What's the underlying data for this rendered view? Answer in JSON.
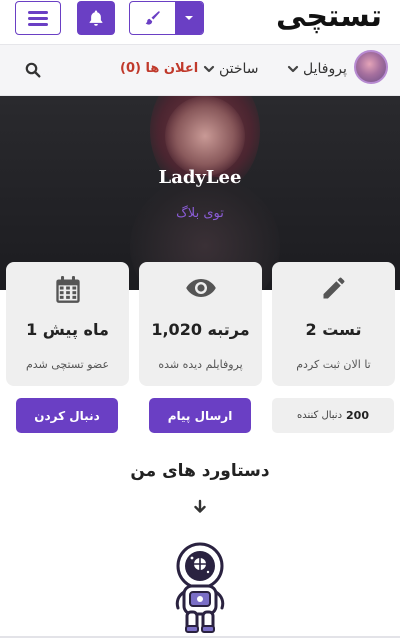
{
  "header": {
    "logo_text": "تستچی",
    "menu_icon": "hamburger-icon",
    "bell_icon": "bell-icon",
    "theme_icon": "brush-icon",
    "accent_color": "#6a3fc4"
  },
  "nav": {
    "profile_label": "پروفایل",
    "build_label": "ساختن",
    "ads_label": "اعلان ها (0)",
    "search_icon": "search-icon"
  },
  "hero": {
    "username": "LadyLee",
    "subtitle": "توی بلاگ"
  },
  "stats": [
    {
      "icon": "pencil-icon",
      "value": "2 تست",
      "label": "تا الان ثبت کردم"
    },
    {
      "icon": "eye-icon",
      "value": "1,020 مرتبه",
      "label": "پروفایلم دیده شده"
    },
    {
      "icon": "calendar-icon",
      "value": "1 ماه پیش",
      "label": "عضو تستچی شدم"
    }
  ],
  "actions": {
    "follow_label": "دنبال کردن",
    "message_label": "ارسال پیام",
    "followers_count": "200",
    "followers_label": "دنبال کننده"
  },
  "achievements": {
    "title": "دستاورد های من"
  }
}
